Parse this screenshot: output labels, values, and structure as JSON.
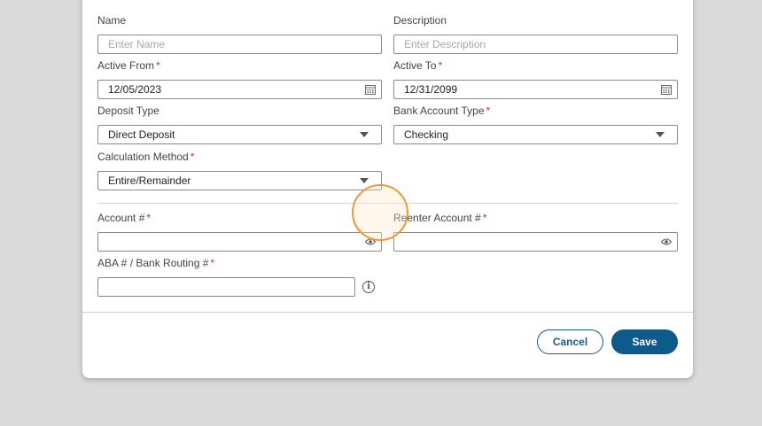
{
  "form": {
    "name": {
      "label": "Name",
      "placeholder": "Enter Name",
      "required": false
    },
    "description": {
      "label": "Description",
      "placeholder": "Enter Description",
      "required": false
    },
    "active_from": {
      "label": "Active From",
      "value": "12/05/2023",
      "required_mark": "*"
    },
    "active_to": {
      "label": "Active To",
      "value": "12/31/2099",
      "required_mark": "*"
    },
    "deposit_type": {
      "label": "Deposit Type",
      "value": "Direct Deposit"
    },
    "bank_account_type": {
      "label": "Bank Account Type",
      "value": "Checking",
      "required_mark": "*"
    },
    "calculation_method": {
      "label": "Calculation Method",
      "value": "Entire/Remainder",
      "required_mark": "*"
    },
    "account_number": {
      "label": "Account #",
      "value": "",
      "required_mark": "*"
    },
    "reenter_account_number": {
      "label": "Reenter Account #",
      "value": "",
      "required_mark": "*"
    },
    "aba_routing": {
      "label": "ABA # / Bank Routing #",
      "value": "",
      "required_mark": "*"
    }
  },
  "footer": {
    "cancel_label": "Cancel",
    "save_label": "Save"
  },
  "icons": {
    "calendar": "calendar-icon",
    "dropdown": "chevron-down-icon",
    "visibility": "eye-icon",
    "info": "info-icon"
  },
  "colors": {
    "accent": "#0e5a8a",
    "required": "#c0392b",
    "cursor_highlight": "#e89a3c"
  }
}
